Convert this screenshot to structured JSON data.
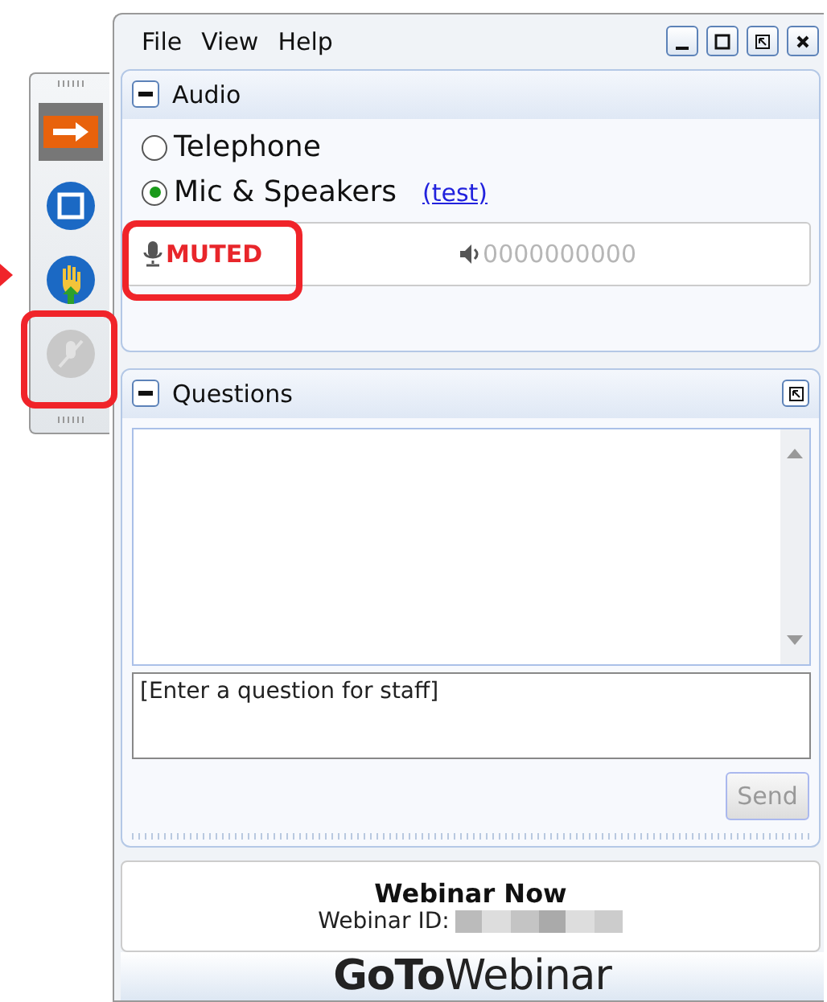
{
  "menu": [
    "File",
    "View",
    "Help"
  ],
  "audio": {
    "title": "Audio",
    "options": [
      {
        "label": "Telephone",
        "selected": false
      },
      {
        "label": "Mic & Speakers",
        "selected": true
      }
    ],
    "test_link": "(test)",
    "mic_status": "MUTED",
    "speaker_meter": "0000000000"
  },
  "toolbar": [
    {
      "kind": "arrow",
      "disabled": false
    },
    {
      "kind": "screen",
      "disabled": false
    },
    {
      "kind": "hand",
      "disabled": false
    },
    {
      "kind": "mic",
      "disabled": true
    }
  ],
  "questions": {
    "title": "Questions",
    "placeholder": "[Enter a question for staff]",
    "send": "Send",
    "send_disabled": true
  },
  "webinar": {
    "name": "Webinar Now",
    "id_label": "Webinar ID:"
  },
  "logo": "**GoTo**Webinar"
}
